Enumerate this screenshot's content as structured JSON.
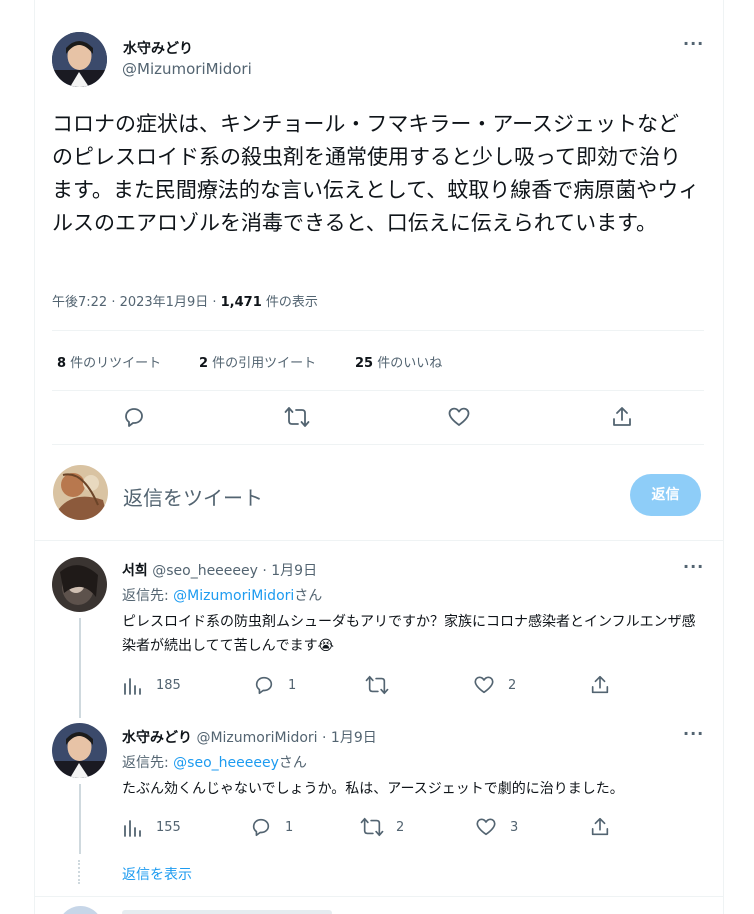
{
  "main_tweet": {
    "author_name": "水守みどり",
    "author_handle": "@MizumoriMidori",
    "more": "···",
    "text": "コロナの症状は、キンチョール・フマキラー・アースジェットなどのピレスロイド系の殺虫剤を通常使用すると少し吸って即効で治ります。また民間療法的な言い伝えとして、蚊取り線香で病原菌やウィルスのエアロゾルを消毒できると、口伝えに伝えられています。",
    "time": "午後7:22 · 2023年1月9日 · ",
    "views_count": "1,471",
    "views_label": " 件の表示",
    "retweets_count": "8",
    "retweets_label": " 件のリツイート",
    "quotes_count": "2",
    "quotes_label": " 件の引用ツイート",
    "likes_count": "25",
    "likes_label": " 件のいいね"
  },
  "composer": {
    "placeholder": "返信をツイート",
    "button_label": "返信"
  },
  "replies": [
    {
      "author_name": "서희",
      "author_handle": "@seo_heeeeey",
      "date": " · 1月9日",
      "replying_prefix": "返信先: ",
      "replying_to": "@MizumoriMidori",
      "replying_suffix": "さん",
      "text": "ピレスロイド系の防虫剤ムシューダもアリですか？家族にコロナ感染者とインフルエンザ感染者が続出してて苦しんでます😭",
      "views": "185",
      "replies": "1",
      "retweets": "",
      "likes": "2"
    },
    {
      "author_name": "水守みどり",
      "author_handle": "@MizumoriMidori",
      "date": " · 1月9日",
      "replying_prefix": "返信先: ",
      "replying_to": "@seo_heeeeey",
      "replying_suffix": "さん",
      "text": "たぶん効くんじゃないでしょうか。私は、アースジェットで劇的に治りました。",
      "views": "155",
      "replies": "1",
      "retweets": "2",
      "likes": "3"
    }
  ],
  "show_replies": "返信を表示",
  "colors": {
    "accent": "#1d9bf0",
    "button_disabled": "#8ecdf8",
    "secondary_text": "#536471",
    "divider": "#eff3f4"
  }
}
